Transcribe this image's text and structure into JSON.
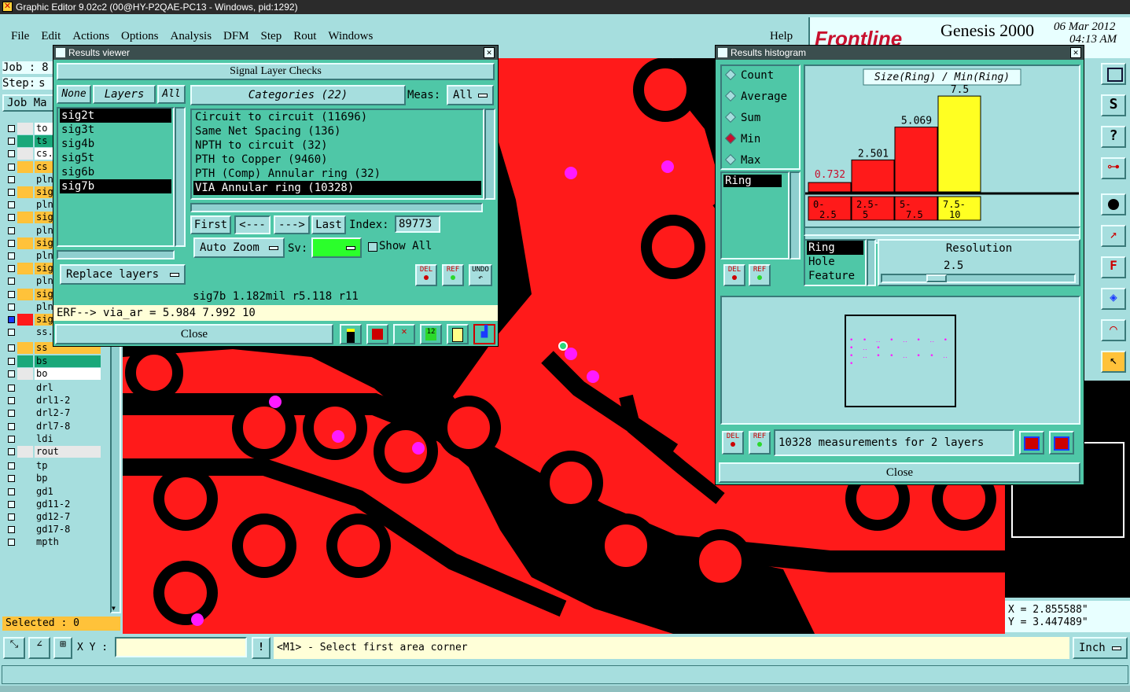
{
  "window_title": "Graphic Editor 9.02c2 (00@HY-P2QAE-PC13 - Windows, pid:1292)",
  "menu": [
    "File",
    "Edit",
    "Actions",
    "Options",
    "Analysis",
    "DFM",
    "Step",
    "Rout",
    "Windows"
  ],
  "menu_help": "Help",
  "brand": {
    "logo": "Frontline",
    "product": "Genesis 2000",
    "date": "06 Mar 2012",
    "time": "04:13 AM"
  },
  "left_panel": {
    "job_label": "Job :",
    "job_value": "8",
    "step_label": "Step:",
    "step_value": "s",
    "jobmatrix_label": "Job Ma",
    "layers": [
      {
        "name": "to",
        "color": "#ffffff"
      },
      {
        "name": "ts",
        "color": "#1aa87a"
      },
      {
        "name": "cs.",
        "color": "#ffffff"
      },
      {
        "name": "cs",
        "color": "#ffc23a"
      },
      {
        "name": "pln",
        "color": "#a6dede"
      },
      {
        "name": "sig",
        "color": "#ffc23a"
      },
      {
        "name": "pln",
        "color": "#a6dede"
      },
      {
        "name": "sig",
        "color": "#ffc23a"
      },
      {
        "name": "pln",
        "color": "#a6dede"
      },
      {
        "name": "sig",
        "color": "#ffc23a"
      },
      {
        "name": "pln",
        "color": "#a6dede"
      },
      {
        "name": "sig",
        "color": "#ffc23a"
      },
      {
        "name": "pln",
        "color": "#a6dede"
      },
      {
        "name": "sig",
        "color": "#ffc23a"
      },
      {
        "name": "pln7b",
        "color": "#a6dede"
      },
      {
        "name": "sig7b",
        "color": "#ffc23a"
      },
      {
        "name": "ss.etch",
        "color": "#a6dede"
      },
      {
        "name": "ss",
        "color": "#ffc23a"
      },
      {
        "name": "bs",
        "color": "#1aa87a"
      },
      {
        "name": "bo",
        "color": "#ffffff"
      },
      {
        "name": "drl",
        "color": "#a6dede"
      },
      {
        "name": "drl1-2",
        "color": "#a6dede"
      },
      {
        "name": "drl2-7",
        "color": "#a6dede"
      },
      {
        "name": "drl7-8",
        "color": "#a6dede"
      },
      {
        "name": "ldi",
        "color": "#a6dede"
      },
      {
        "name": "rout",
        "color": "#e8e8e8"
      },
      {
        "name": "tp",
        "color": "#a6dede"
      },
      {
        "name": "bp",
        "color": "#a6dede"
      },
      {
        "name": "gd1",
        "color": "#a6dede"
      },
      {
        "name": "gd11-2",
        "color": "#a6dede"
      },
      {
        "name": "gd12-7",
        "color": "#a6dede"
      },
      {
        "name": "gd17-8",
        "color": "#a6dede"
      },
      {
        "name": "mpth",
        "color": "#a6dede"
      }
    ],
    "selected_label": "Selected : 0"
  },
  "results_viewer": {
    "title": "Results viewer",
    "header": "Signal Layer Checks",
    "none_btn": "None",
    "layers_btn": "Layers",
    "all_btn": "All",
    "layer_list": [
      "sig2t",
      "sig3t",
      "sig4b",
      "sig5t",
      "sig6b",
      "sig7b"
    ],
    "selected_layers": [
      "sig2t",
      "sig7b"
    ],
    "categories_label": "Categories (22)",
    "meas_label": "Meas:",
    "meas_value": "All",
    "categories": [
      "Circuit to circuit (11696)",
      "Same Net Spacing (136)",
      "NPTH to circuit (32)",
      "PTH to Copper (9460)",
      "PTH (Comp) Annular ring (32)",
      "VIA Annular ring (10328)"
    ],
    "selected_category": "VIA Annular ring (10328)",
    "first_btn": "First",
    "prev_btn": "<---",
    "next_btn": "--->",
    "last_btn": "Last",
    "index_label": "Index:",
    "index_value": "89773",
    "autozoom_label": "Auto Zoom",
    "sv_label": "Sv:",
    "show_all_label": "Show All",
    "replace_layers_label": "Replace layers",
    "del_label": "DEL",
    "ref_label": "REF",
    "undo_label": "UNDO",
    "status_line": "sig7b 1.182mil  r5.118  r11",
    "erf_line": "ERF--> via_ar = 5.984 7.992 10",
    "close_label": "Close"
  },
  "histogram": {
    "title": "Results histogram",
    "modes": [
      "Count",
      "Average",
      "Sum",
      "Min",
      "Max"
    ],
    "selected_mode": "Min",
    "list_item": "Ring",
    "chart_title": "Size(Ring) / Min(Ring)",
    "resolution_label": "Resolution",
    "resolution_value": "2.5",
    "attr_list": [
      "Ring",
      "Hole",
      "Feature"
    ],
    "selected_attr": "Ring",
    "summary": "10328 measurements for 2 layers",
    "del_label": "DEL",
    "ref_label": "REF",
    "close_label": "Close",
    "colors": {
      "bar": "#ff1a1a",
      "selected_bar": "#ffff22"
    }
  },
  "chart_data": {
    "type": "bar",
    "title": "Size(Ring) / Min(Ring)",
    "categories": [
      "0-\n2.5",
      "2.5-\n5",
      "5-\n7.5",
      "7.5-\n10"
    ],
    "category_labels": [
      [
        "0-",
        "2.5"
      ],
      [
        "2.5-",
        "5"
      ],
      [
        "5-",
        "7.5"
      ],
      [
        "7.5-",
        "10"
      ]
    ],
    "values": [
      0.732,
      2.501,
      5.069,
      7.5
    ],
    "value_labels": [
      "0.732",
      "2.501",
      "5.069",
      "7.5"
    ],
    "selected_index": 3,
    "ylim": [
      0,
      8
    ]
  },
  "coords": {
    "x": "X = 2.855588\"",
    "y": "Y = 3.447489\""
  },
  "bottom_bar": {
    "xy_label": "X Y :",
    "xy_value": "",
    "excl_label": "!",
    "prompt": "<M1> - Select first area corner",
    "units": "Inch"
  }
}
